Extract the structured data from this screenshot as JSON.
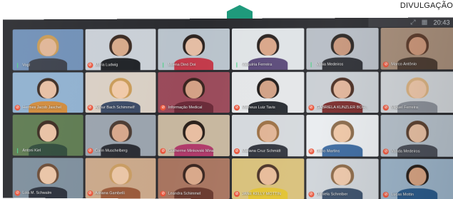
{
  "credit": {
    "text": "DIVULGAÇÃO"
  },
  "screen": {
    "clock": "20:43"
  },
  "brand_color": "#1f9a7c",
  "participants": [
    {
      "name": "Vogl",
      "muted": false,
      "bg": "#6f8fb6",
      "skin": "#e0b596",
      "hair": "#c89a55",
      "shirt": "#3a3f4a"
    },
    {
      "name": "Maria Ludwig",
      "muted": true,
      "bg": "#c9cfd6",
      "skin": "#d6a98a",
      "hair": "#3a2a22",
      "shirt": "#1f2226"
    },
    {
      "name": "Milena Dinó Doi",
      "muted": false,
      "bg": "#b9c3cc",
      "skin": "#e4bda4",
      "hair": "#2d2420",
      "shirt": "#c33a4a"
    },
    {
      "name": "Valquíria Ferreira",
      "muted": false,
      "bg": "#dfe3e6",
      "skin": "#d9a689",
      "hair": "#2a2320",
      "shirt": "#5b4a7a"
    },
    {
      "name": "Vania Medeiros",
      "muted": false,
      "bg": "#b7bdc5",
      "skin": "#c7957a",
      "hair": "#2a2522",
      "shirt": "#2d2f35"
    },
    {
      "name": "Marco Antônio",
      "muted": true,
      "bg": "#a58c78",
      "skin": "#c99477",
      "hair": "#5a3a2a",
      "shirt": "#4a3a30"
    },
    {
      "name": "Hermes Jacob Jaschel",
      "muted": true,
      "bg": "#8fb0cf",
      "skin": "#e6bea2",
      "hair": "#3b2b22",
      "shirt": "#d08a3a"
    },
    {
      "name": "Arthur Bach Schimmelf",
      "muted": true,
      "bg": "#d9cfc4",
      "skin": "#f0c9a8",
      "hair": "#c99b58",
      "shirt": "#3b4a66"
    },
    {
      "name": "Informação Medical",
      "muted": true,
      "bg": "#9a4a5a",
      "skin": "#d4a186",
      "hair": "#3a2520",
      "shirt": "#6a2a38"
    },
    {
      "name": "Matheus Luiz Tavis",
      "muted": true,
      "bg": "#e4e6e8",
      "skin": "#d1a084",
      "hair": "#1f1b19",
      "shirt": "#262a30"
    },
    {
      "name": "GABRIELA KUNZLER BOH...",
      "muted": true,
      "bg": "#c9ced3",
      "skin": "#e2b59a",
      "hair": "#4a2e22",
      "shirt": "#7a2a2a"
    },
    {
      "name": "Miguel Ferreira",
      "muted": true,
      "bg": "#cfd3d7",
      "skin": "#edc6a8",
      "hair": "#d7b080",
      "shirt": "#8a8f98"
    },
    {
      "name": "Antoni Kiel",
      "muted": false,
      "bg": "#5d7a50",
      "skin": "#e8c1a3",
      "hair": "#3a2a20",
      "shirt": "#2f4a3a"
    },
    {
      "name": "Carin Muschelberg",
      "muted": true,
      "bg": "#9aa3ad",
      "skin": "#d6a78b",
      "hair": "#4a3a32",
      "shirt": "#2a2c33"
    },
    {
      "name": "Guilherme Minkovski Mina",
      "muted": true,
      "bg": "#c7b79f",
      "skin": "#e8bea1",
      "hair": "#2a201b",
      "shirt": "#b03a6a"
    },
    {
      "name": "Mariana Cruz Schmidt",
      "muted": true,
      "bg": "#d4d8dc",
      "skin": "#e0b394",
      "hair": "#9c7044",
      "shirt": "#30343d"
    },
    {
      "name": "Dario Martins",
      "muted": true,
      "bg": "#e9ecef",
      "skin": "#f0c8a7",
      "hair": "#8a6a4a",
      "shirt": "#3c6aa0"
    },
    {
      "name": "Vanda Medeiros",
      "muted": true,
      "bg": "#b5c0ca",
      "skin": "#e7bfa2",
      "hair": "#5a4030",
      "shirt": "#4a4e58"
    },
    {
      "name": "Lola M. Schwalm",
      "muted": true,
      "bg": "#7d8e9c",
      "skin": "#e9c4a6",
      "hair": "#6a4a34",
      "shirt": "#2a2f3a"
    },
    {
      "name": "Adriana Gambelli",
      "muted": true,
      "bg": "#caa88a",
      "skin": "#eac5a6",
      "hair": "#c89c62",
      "shirt": "#9a5a3a"
    },
    {
      "name": "Leandra Schimmel",
      "muted": true,
      "bg": "#a87560",
      "skin": "#d9a88a",
      "hair": "#3a2620",
      "shirt": "#6a3a2e"
    },
    {
      "name": "JANE KELLY MOTTIN",
      "muted": true,
      "bg": "#d8c07a",
      "skin": "#e7bb98",
      "hair": "#4a3226",
      "shirt": "#e2c230"
    },
    {
      "name": "Daniela Schreiber",
      "muted": true,
      "bg": "#cfd4d9",
      "skin": "#eec8aa",
      "hair": "#8c6a48",
      "shirt": "#3a4f6a"
    },
    {
      "name": "Lucas Mottin",
      "muted": true,
      "bg": "#9bb3c8",
      "skin": "#d7a382",
      "hair": "#261e19",
      "shirt": "#2a5a8a"
    }
  ]
}
